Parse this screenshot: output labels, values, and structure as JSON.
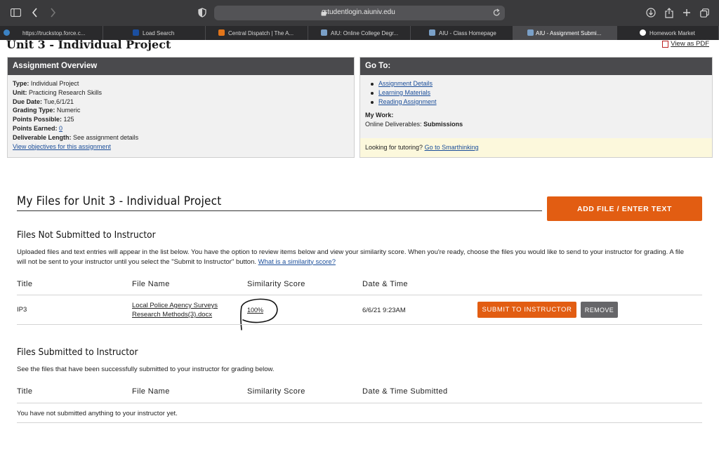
{
  "browser": {
    "url": "studentlogin.aiuniv.edu",
    "tabs": [
      {
        "label": "https://truckstop.force.c...",
        "favicon_color": "#3b82c4"
      },
      {
        "label": "Load Search",
        "favicon_color": "#1b4fa0"
      },
      {
        "label": "Central Dispatch | The A...",
        "favicon_color": "#e2751a"
      },
      {
        "label": "AIU: Online College Degr...",
        "favicon_color": "#7aa0c8"
      },
      {
        "label": "AIU - Class Homepage",
        "favicon_color": "#7aa0c8"
      },
      {
        "label": "AIU - Assignment Submi...",
        "favicon_color": "#7aa0c8"
      },
      {
        "label": "Homework Market",
        "favicon_color": "#ffffff"
      }
    ]
  },
  "page": {
    "title": "Unit 3 - Individual Project",
    "pdf_link": "View as PDF"
  },
  "overview": {
    "heading": "Assignment Overview",
    "type_label": "Type:",
    "type_value": "Individual Project",
    "unit_label": "Unit:",
    "unit_value": "Practicing Research Skills",
    "due_label": "Due Date:",
    "due_value": "Tue,6/1/21",
    "grading_label": "Grading Type:",
    "grading_value": "Numeric",
    "possible_label": "Points Possible:",
    "possible_value": "125",
    "earned_label": "Points Earned:",
    "earned_value": "0",
    "length_label": "Deliverable Length:",
    "length_value": "See assignment details",
    "objectives_link": "View objectives for this assignment"
  },
  "goto": {
    "heading": "Go To:",
    "links": [
      "Assignment Details",
      "Learning Materials",
      "Reading Assignment"
    ],
    "mywork_label": "My Work:",
    "deliverables_label": "Online Deliverables:",
    "deliverables_value": "Submissions",
    "tutoring_text": "Looking for tutoring?",
    "tutoring_link": "Go to Smarthinking"
  },
  "myfiles": {
    "heading": "My Files for Unit 3 - Individual Project",
    "add_button": "ADD FILE / ENTER TEXT"
  },
  "not_submitted": {
    "heading": "Files Not Submitted to Instructor",
    "description": "Uploaded files and text entries will appear in the list below. You have the option to review items below and view your similarity score. When you're ready, choose the files you would like to send to your instructor for grading. A file will not be sent to your instructor until you select the \"Submit to Instructor\" button.",
    "similarity_link": "What is a similarity score?",
    "columns": [
      "Title",
      "File Name",
      "Similarity Score",
      "Date & Time"
    ],
    "row": {
      "title": "IP3",
      "file_line1": "Local Police Agency Surveys",
      "file_line2": "Research Methods(3).docx",
      "score": "100%",
      "datetime": "6/6/21 9:23AM",
      "submit_button": "SUBMIT TO INSTRUCTOR",
      "remove_button": "REMOVE"
    }
  },
  "submitted": {
    "heading": "Files Submitted to Instructor",
    "description": "See the files that have been successfully submitted to your instructor for grading below.",
    "columns": [
      "Title",
      "File Name",
      "Similarity Score",
      "Date & Time Submitted"
    ],
    "empty_text": "You have not submitted anything to your instructor yet."
  },
  "colors": {
    "accent": "#e25d12",
    "header_dark": "#4a4a4d",
    "link": "#1a4d99"
  }
}
